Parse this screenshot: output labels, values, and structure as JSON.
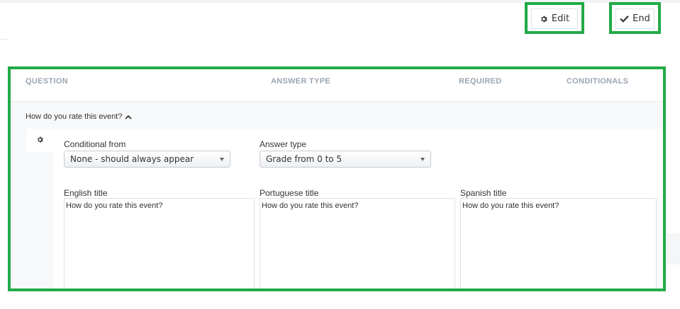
{
  "toolbar": {
    "edit_label": "Edit",
    "end_label": "End"
  },
  "table": {
    "headers": {
      "question": "QUESTION",
      "answer_type": "ANSWER TYPE",
      "required": "REQUIRED",
      "conditionals": "CONDITIONALS"
    }
  },
  "question": {
    "text": "How do you rate this event?",
    "expanded": true
  },
  "form": {
    "conditional_from": {
      "label": "Conditional from",
      "value": "None - should always appear"
    },
    "answer_type": {
      "label": "Answer type",
      "value": "Grade from 0 to 5"
    },
    "titles": {
      "english": {
        "label": "English title",
        "value": "How do you rate this event?"
      },
      "portuguese": {
        "label": "Portuguese title",
        "value": "How do you rate this event?"
      },
      "spanish": {
        "label": "Spanish title",
        "value": "How do you rate this event?"
      }
    }
  },
  "icons": {
    "edit": "cog-icon",
    "end": "check-icon",
    "expand": "chevron-up-icon",
    "settings_tab": "cog-icon"
  },
  "colors": {
    "highlight": "#22aa47",
    "header_text": "#9aa6b2",
    "panel_bg": "#f7f8fa"
  }
}
